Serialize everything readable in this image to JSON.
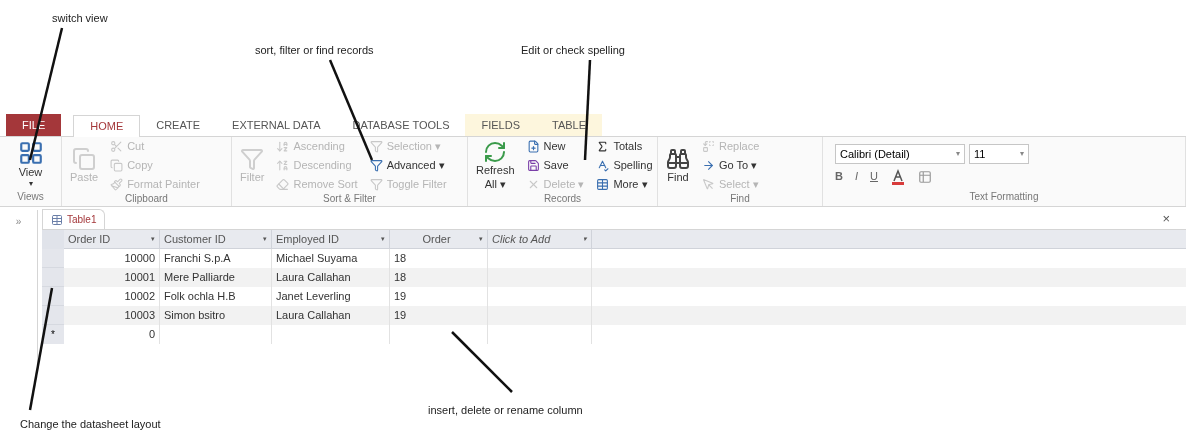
{
  "annotations": [
    {
      "text": "switch view"
    },
    {
      "text": "sort, filter or find records"
    },
    {
      "text": "Edit or check spelling"
    },
    {
      "text": "Change the datasheet layout"
    },
    {
      "text": "insert, delete or rename column"
    }
  ],
  "tabs": [
    {
      "label": "FILE",
      "kind": "file",
      "selected": false
    },
    {
      "label": "HOME",
      "kind": "tab",
      "selected": true
    },
    {
      "label": "CREATE",
      "kind": "tab",
      "selected": false
    },
    {
      "label": "EXTERNAL DATA",
      "kind": "tab",
      "selected": false
    },
    {
      "label": "DATABASE TOOLS",
      "kind": "tab",
      "selected": false
    },
    {
      "label": "FIELDS",
      "kind": "context",
      "selected": false
    },
    {
      "label": "TABLE",
      "kind": "context",
      "selected": false
    }
  ],
  "ribbon": {
    "views": {
      "label": "Views",
      "button": "View",
      "caret": "▾"
    },
    "clipboard": {
      "label": "Clipboard",
      "paste": {
        "label": "Paste",
        "disabled": true
      },
      "items": [
        {
          "label": "Cut",
          "disabled": true
        },
        {
          "label": "Copy",
          "disabled": true
        },
        {
          "label": "Format Painter",
          "disabled": true
        }
      ]
    },
    "sort_filter": {
      "label": "Sort & Filter",
      "filter": {
        "label": "Filter",
        "disabled": true
      },
      "items": [
        {
          "label": "Ascending",
          "disabled": true
        },
        {
          "label": "Descending",
          "disabled": true
        },
        {
          "label": "Remove Sort",
          "disabled": true
        },
        {
          "label": "Selection ▾",
          "disabled": true
        },
        {
          "label": "Advanced ▾",
          "disabled": false
        },
        {
          "label": "Toggle Filter",
          "disabled": true
        }
      ]
    },
    "records": {
      "label": "Records",
      "refresh": {
        "label": "Refresh All ▾",
        "disabled": false
      },
      "items": [
        {
          "label": "New",
          "disabled": false
        },
        {
          "label": "Save",
          "disabled": false
        },
        {
          "label": "Delete ▾",
          "disabled": true
        },
        {
          "label": "Totals",
          "disabled": false
        },
        {
          "label": "Spelling",
          "disabled": false
        },
        {
          "label": "More ▾",
          "disabled": false
        }
      ]
    },
    "find": {
      "label": "Find",
      "find": {
        "label": "Find",
        "disabled": false
      },
      "items": [
        {
          "label": "Replace",
          "disabled": true
        },
        {
          "label": "Go To ▾",
          "disabled": false
        },
        {
          "label": "Select ▾",
          "disabled": true
        }
      ]
    },
    "text_formatting": {
      "label": "Text Formatting",
      "font": "Calibri (Detail)",
      "font_caret": "▾",
      "size": "11",
      "size_caret": "▾",
      "styles": [
        "B",
        "I",
        "U"
      ]
    }
  },
  "document": {
    "nav_toggle": "»",
    "tab": "Table1",
    "close": "×",
    "columns": [
      {
        "label": "Order ID",
        "menu": "▾",
        "italic": false
      },
      {
        "label": "Customer ID",
        "menu": "▾",
        "italic": false
      },
      {
        "label": "Employed ID",
        "menu": "▾",
        "italic": false
      },
      {
        "label": "Order",
        "menu": "▾",
        "italic": false
      },
      {
        "label": "Click to Add",
        "menu": "▾",
        "italic": true
      }
    ],
    "rows": [
      {
        "cells": [
          "10000",
          "Franchi S.p.A",
          "Michael Suyama",
          "18"
        ]
      },
      {
        "cells": [
          "10001",
          "Mere Palliarde",
          "Laura Callahan",
          "18"
        ]
      },
      {
        "cells": [
          "10002",
          "Folk ochla H.B",
          "Janet Leverling",
          "19"
        ]
      },
      {
        "cells": [
          "10003",
          "Simon bsitro",
          "Laura Callahan",
          "19"
        ]
      }
    ],
    "new_row": {
      "marker": "*",
      "cells": [
        "0"
      ]
    }
  }
}
